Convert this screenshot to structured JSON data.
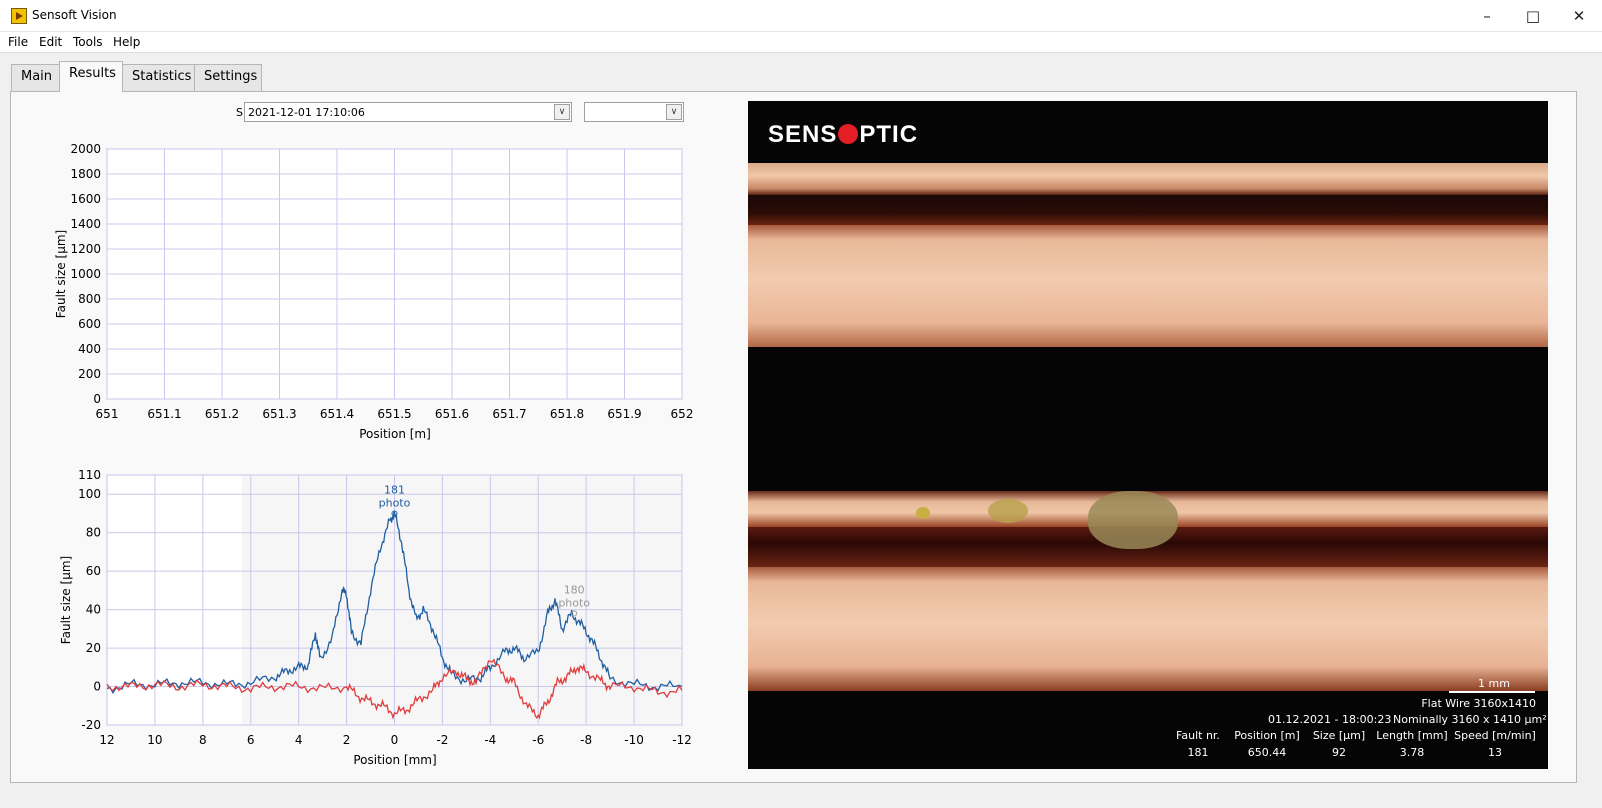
{
  "window": {
    "title": "Sensoft Vision"
  },
  "menu": [
    "File",
    "Edit",
    "Tools",
    "Help"
  ],
  "tabs": [
    "Main",
    "Results",
    "Statistics",
    "Settings"
  ],
  "spool": {
    "label": "Spool:",
    "value": "2021-12-01 17:10:06",
    "secondary_value": ""
  },
  "chart_data": [
    {
      "type": "scatter",
      "xlabel": "Position [m]",
      "ylabel": "Fault size [µm]",
      "xlim": [
        651,
        652
      ],
      "ylim": [
        0,
        2000
      ],
      "xticks": [
        "651",
        "651.1",
        "651.2",
        "651.3",
        "651.4",
        "651.5",
        "651.6",
        "651.7",
        "651.8",
        "651.9",
        "652"
      ],
      "yticks": [
        "0",
        "200",
        "400",
        "600",
        "800",
        "1000",
        "1200",
        "1400",
        "1600",
        "1800",
        "2000"
      ],
      "grid": true,
      "series": []
    },
    {
      "type": "line",
      "xlabel": "Position [mm]",
      "ylabel": "Fault size [µm]",
      "xlim": [
        12,
        -12
      ],
      "ylim": [
        -20,
        110
      ],
      "xticks": [
        "12",
        "10",
        "8",
        "6",
        "4",
        "2",
        "0",
        "-2",
        "-4",
        "-6",
        "-8",
        "-10",
        "-12"
      ],
      "yticks": [
        "-20",
        "0",
        "20",
        "40",
        "60",
        "80",
        "100",
        "110"
      ],
      "grid": true,
      "series": [
        {
          "color": "#1f5fa0",
          "x": [
            12,
            11,
            10,
            9,
            8,
            7,
            6,
            5,
            4.5,
            4,
            3.6,
            3.3,
            3.1,
            2.6,
            2.2,
            2.0,
            1.8,
            1.4,
            1.0,
            0.6,
            0.2,
            0.0,
            -0.3,
            -0.6,
            -0.9,
            -1.2,
            -1.6,
            -2.0,
            -2.4,
            -3.0,
            -3.6,
            -4.0,
            -4.6,
            -5.0,
            -5.4,
            -6.0,
            -6.4,
            -6.7,
            -7.0,
            -7.4,
            -7.8,
            -8.2,
            -8.6,
            -9.0,
            -10,
            -11,
            -12
          ],
          "y": [
            -1,
            1,
            1,
            2,
            2,
            1,
            2,
            5,
            8,
            10,
            11,
            28,
            14,
            25,
            50,
            48,
            28,
            22,
            50,
            72,
            86,
            90,
            75,
            50,
            35,
            40,
            30,
            15,
            6,
            3,
            5,
            10,
            18,
            20,
            15,
            18,
            38,
            45,
            30,
            38,
            32,
            25,
            15,
            4,
            1,
            0,
            0
          ]
        },
        {
          "color": "#e03c3c",
          "x": [
            12,
            11,
            10,
            9,
            8,
            7,
            6,
            5,
            4,
            3,
            2,
            1.5,
            1.0,
            0.5,
            0.0,
            -0.5,
            -1.0,
            -1.6,
            -2.0,
            -2.6,
            -3.0,
            -3.4,
            -4.0,
            -4.6,
            -5.0,
            -5.5,
            -6.0,
            -6.4,
            -6.8,
            -7.2,
            -7.6,
            -8.0,
            -8.6,
            -9.0,
            -10,
            -11,
            -12
          ],
          "y": [
            0,
            0,
            1,
            0,
            1,
            0,
            -1,
            0,
            0,
            -1,
            0,
            -5,
            -8,
            -10,
            -14,
            -12,
            -7,
            -2,
            5,
            8,
            4,
            2,
            15,
            5,
            2,
            -10,
            -15,
            -8,
            2,
            5,
            10,
            8,
            3,
            0,
            0,
            -3,
            -2
          ]
        }
      ],
      "annotations": [
        {
          "lines": [
            "181",
            "photo"
          ],
          "x": 0.0,
          "y": 90,
          "color": "#1f5fa0"
        },
        {
          "lines": [
            "180",
            "photo"
          ],
          "x": -7.5,
          "y": 38,
          "color": "#999999"
        }
      ]
    }
  ],
  "image": {
    "logo_left": "S",
    "logo_mid": "ENS",
    "logo_right": "PTIC",
    "scale_label": "1 mm",
    "product": "Flat Wire 3160x1410",
    "datetime": "01.12.2021 - 18:00:23",
    "nominal": "Nominally 3160 x 1410 µm²",
    "table": {
      "headers": [
        "Fault nr.",
        "Position [m]",
        "Size [µm]",
        "Length [mm]",
        "Speed [m/min]"
      ],
      "values": [
        "181",
        "650.44",
        "92",
        "3.78",
        "13"
      ]
    }
  }
}
